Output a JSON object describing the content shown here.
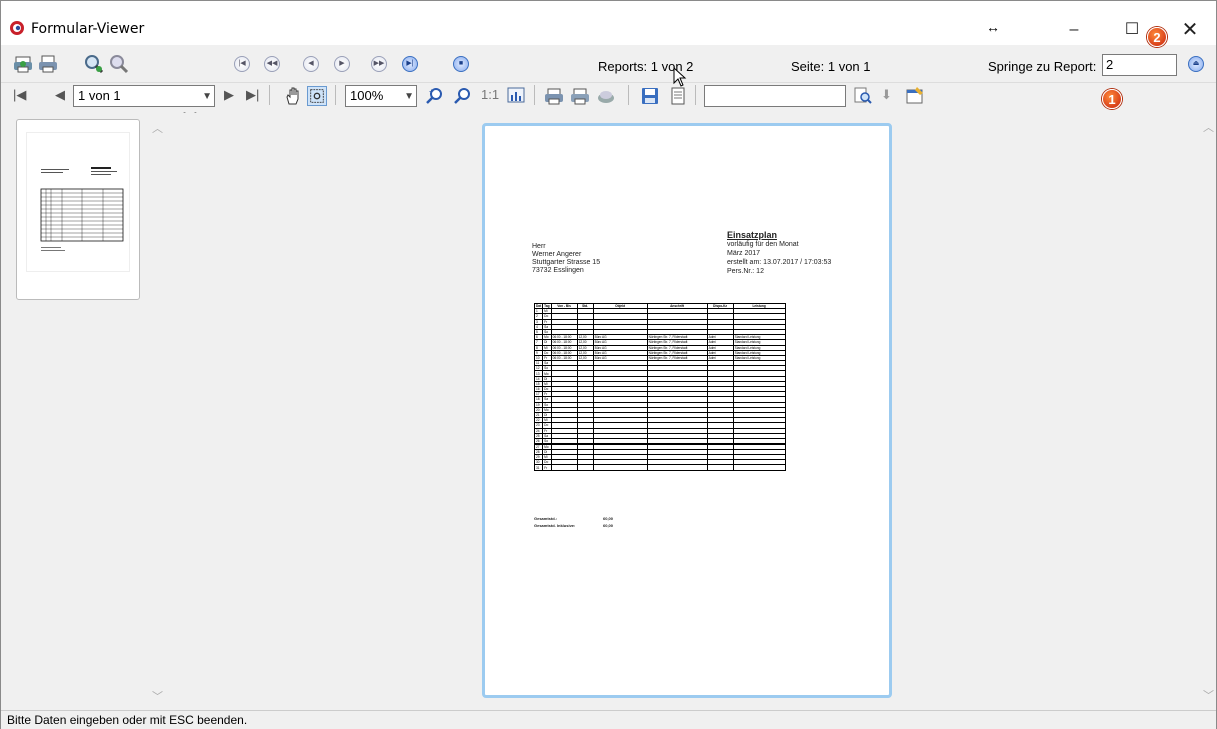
{
  "window": {
    "title": "Formular-Viewer",
    "resize_glyph": "↔",
    "min_glyph": "–",
    "max_glyph": "☐",
    "close_glyph": "✕"
  },
  "badges": [
    "2",
    "1"
  ],
  "toolbar1": {
    "one_to_one": "1:1",
    "reports": "Reports: 1 von 2",
    "seite": "Seite: 1 von 1",
    "springe_label": "Springe zu Report:",
    "springe_value": "2"
  },
  "toolbar2": {
    "page_combo": "1 von 1",
    "zoom_combo": "100%",
    "one_to_one": "1:1",
    "search_value": ""
  },
  "document": {
    "address": [
      "Herr",
      "Werner Angerer",
      "Stuttgarter Strasse 15",
      "73732 Esslingen"
    ],
    "title": "Einsatzplan",
    "meta": [
      "vorläufig für den Monat",
      "März 2017",
      "erstellt am: 13.07.2017 / 17:03:53",
      "Pers.Nr.: 12"
    ],
    "table_headers": [
      "Dat",
      "Tag",
      "Von - Bis",
      "Std.",
      "Objekt",
      "Anschrift",
      "Dispo-Kz",
      "Leistung"
    ],
    "rows": [
      [
        "1",
        "Mi",
        "",
        "",
        "",
        "",
        "",
        ""
      ],
      [
        "2",
        "Do",
        "",
        "",
        "",
        "",
        "",
        ""
      ],
      [
        "3",
        "Fr",
        "",
        "",
        "",
        "",
        "",
        ""
      ],
      [
        "4",
        "Sa",
        "",
        "",
        "",
        "",
        "",
        ""
      ],
      [
        "5",
        "So",
        "",
        "",
        "",
        "",
        "",
        ""
      ],
      [
        "6",
        "Mo",
        "06:00 - 18:00",
        "12,00",
        "Büro AG",
        "Nürtingen Str. 7, Filderstadt",
        "Admi",
        "Standard Leistung"
      ],
      [
        "7",
        "Di",
        "06:00 - 18:00",
        "12,00",
        "Büro AG",
        "Nürtingen Str. 7, Filderstadt",
        "Admi",
        "Standard Leistung"
      ],
      [
        "8",
        "Mi",
        "06:00 - 18:00",
        "12,00",
        "Büro AG",
        "Nürtingen Str. 7, Filderstadt",
        "Admi",
        "Standard Leistung"
      ],
      [
        "9",
        "Do",
        "06:00 - 18:00",
        "12,00",
        "Büro AG",
        "Nürtingen Str. 7, Filderstadt",
        "Admi",
        "Standard Leistung"
      ],
      [
        "10",
        "Fr",
        "06:00 - 18:00",
        "12,00",
        "Büro AG",
        "Nürtingen Str. 7, Filderstadt",
        "Admi",
        "Standard Leistung"
      ],
      [
        "11",
        "Sa",
        "",
        "",
        "",
        "",
        "",
        ""
      ],
      [
        "12",
        "So",
        "",
        "",
        "",
        "",
        "",
        ""
      ],
      [
        "13",
        "Mo",
        "",
        "",
        "",
        "",
        "",
        ""
      ],
      [
        "14",
        "Di",
        "",
        "",
        "",
        "",
        "",
        ""
      ],
      [
        "15",
        "Mi",
        "",
        "",
        "",
        "",
        "",
        ""
      ],
      [
        "16",
        "Do",
        "",
        "",
        "",
        "",
        "",
        ""
      ],
      [
        "17",
        "Fr",
        "",
        "",
        "",
        "",
        "",
        ""
      ],
      [
        "18",
        "Sa",
        "",
        "",
        "",
        "",
        "",
        ""
      ],
      [
        "19",
        "So",
        "",
        "",
        "",
        "",
        "",
        ""
      ],
      [
        "20",
        "Mo",
        "",
        "",
        "",
        "",
        "",
        ""
      ],
      [
        "21",
        "Di",
        "",
        "",
        "",
        "",
        "",
        ""
      ],
      [
        "22",
        "Mi",
        "",
        "",
        "",
        "",
        "",
        ""
      ],
      [
        "23",
        "Do",
        "",
        "",
        "",
        "",
        "",
        ""
      ],
      [
        "24",
        "Fr",
        "",
        "",
        "",
        "",
        "",
        ""
      ],
      [
        "25",
        "Sa",
        "",
        "",
        "",
        "",
        "",
        ""
      ],
      [
        "26",
        "So",
        "",
        "",
        "",
        "",
        "",
        ""
      ],
      [
        "27",
        "Mo",
        "",
        "",
        "",
        "",
        "",
        ""
      ],
      [
        "28",
        "Di",
        "",
        "",
        "",
        "",
        "",
        ""
      ],
      [
        "29",
        "Mi",
        "",
        "",
        "",
        "",
        "",
        ""
      ],
      [
        "30",
        "Do",
        "",
        "",
        "",
        "",
        "",
        ""
      ],
      [
        "31",
        "Fr",
        "",
        "",
        "",
        "",
        "",
        ""
      ]
    ],
    "totals": [
      {
        "label": "Gesamtstd.:",
        "value": "60,00"
      },
      {
        "label": "Gesamtstd. Inklusive:",
        "value": "60,00"
      }
    ]
  },
  "status": "Bitte Daten eingeben oder mit ESC beenden.",
  "colors": {
    "accent": "#3a6fc0",
    "badge": "#d8401a",
    "page_border": "#9ccbf0"
  }
}
